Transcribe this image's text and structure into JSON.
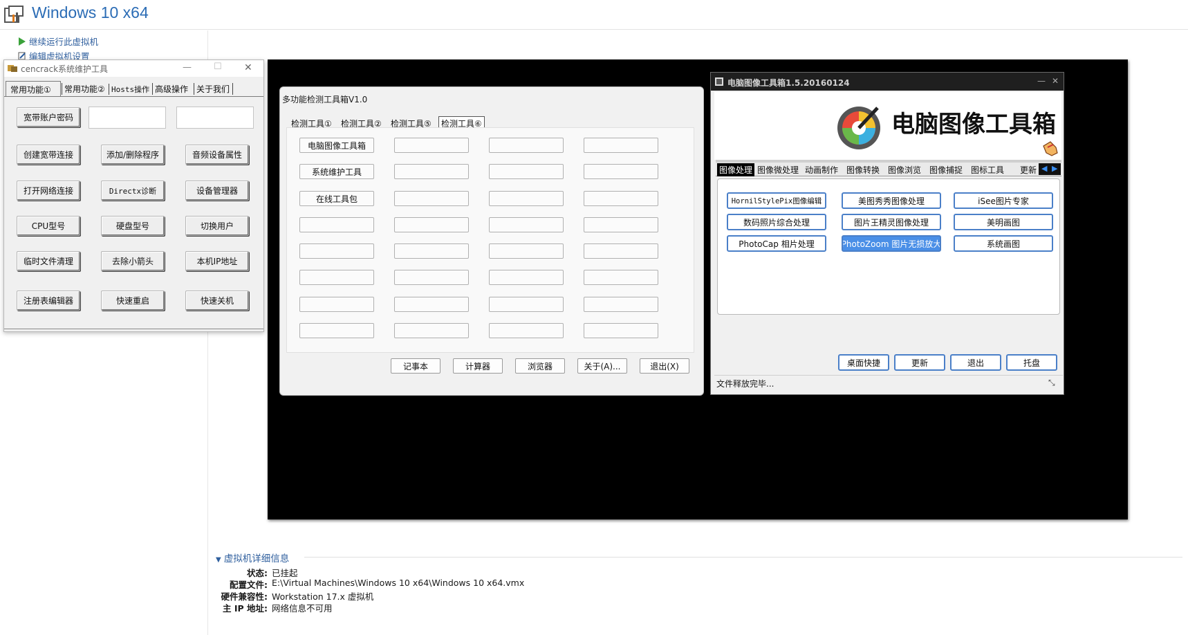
{
  "vm": {
    "title": "Windows 10 x64",
    "commands": [
      "继续运行此虚拟机",
      "编辑虚拟机设置"
    ],
    "details": {
      "heading": "虚拟机详细信息",
      "rows": [
        {
          "label": "状态:",
          "value": "已挂起"
        },
        {
          "label": "配置文件:",
          "value": "E:\\Virtual Machines\\Windows 10 x64\\Windows 10 x64.vmx"
        },
        {
          "label": "硬件兼容性:",
          "value": "Workstation 17.x 虚拟机"
        },
        {
          "label": "主 IP 地址:",
          "value": "网络信息不可用"
        }
      ]
    }
  },
  "cencrack": {
    "title": "cencrack系统维护工具",
    "controls": {
      "minimize": "—",
      "maximize": "☐",
      "close": "✕"
    },
    "tabs": [
      "常用功能①",
      "常用功能②",
      "Hosts操作",
      "高级操作",
      "关于我们"
    ],
    "buttons": [
      "宽带账户密码",
      "创建宽带连接",
      "添加/删除程序",
      "音频设备属性",
      "打开网络连接",
      "Directx诊断",
      "设备管理器",
      "CPU型号",
      "硬盘型号",
      "切换用户",
      "临时文件清理",
      "去除小箭头",
      "本机IP地址",
      "注册表编辑器",
      "快速重启",
      "快速关机"
    ]
  },
  "detect": {
    "title": "多功能检测工具箱V1.0",
    "tabs": [
      "检测工具①",
      "检测工具②",
      "检测工具⑤",
      "检测工具⑥"
    ],
    "col1": [
      "电脑图像工具箱",
      "系统维护工具",
      "在线工具包"
    ],
    "bottom_buttons": [
      "记事本",
      "计算器",
      "浏览器",
      "关于(A)...",
      "退出(X)"
    ]
  },
  "imgtool": {
    "title": "电脑图像工具箱1.5.20160124",
    "controls": {
      "minimize": "—",
      "close": "✕"
    },
    "banner": "电脑图像工具箱",
    "tabs": [
      "图像处理",
      "图像微处理",
      "动画制作",
      "图像转换",
      "图像浏览",
      "图像捕捉",
      "图标工具",
      "更新"
    ],
    "tools": [
      "HornilStylePix图像编辑",
      "美图秀秀图像处理",
      "iSee图片专家",
      "数码照片综合处理",
      "图片王精灵图像处理",
      "美明画图",
      "PhotoCap 相片处理",
      "PhotoZoom 图片无损放大",
      "系统画图"
    ],
    "bottom_buttons": [
      "桌面快捷",
      "更新",
      "退出",
      "托盘"
    ],
    "status": "文件释放完毕...",
    "colors": {
      "selected_tool": "#4a8fe7",
      "tab_selected_bg": "#000000"
    }
  }
}
